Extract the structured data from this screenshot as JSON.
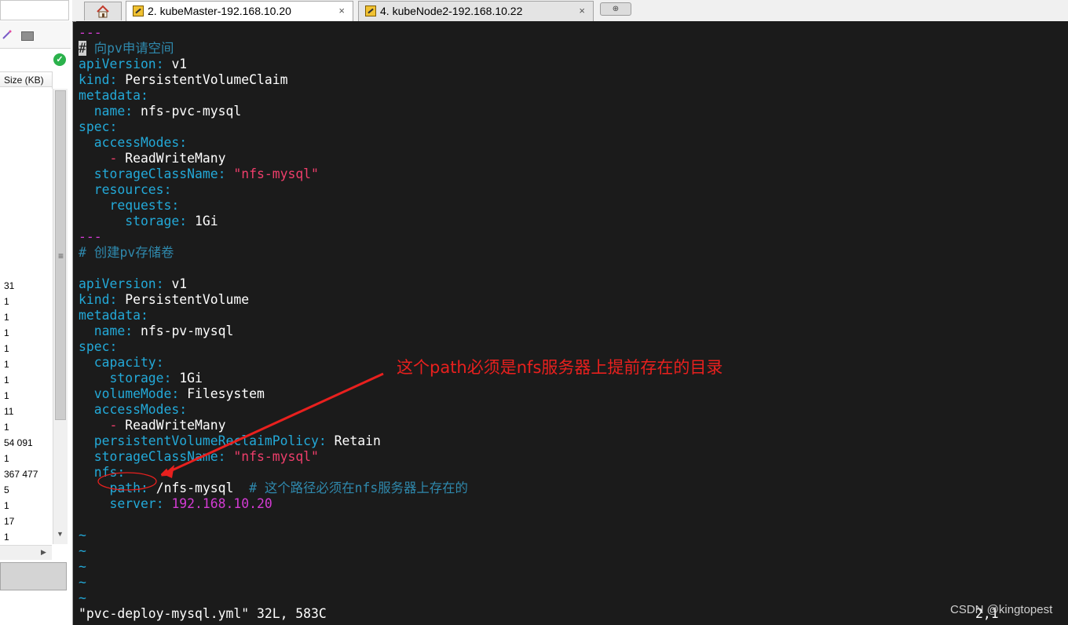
{
  "sidebar": {
    "column_header": "Size (KB)",
    "sizes": [
      "31",
      "1",
      "1",
      "1",
      "1",
      "1",
      "1",
      "1",
      "11",
      "1",
      "54 091",
      "1",
      "367 477",
      "5",
      "1",
      "17",
      "1"
    ]
  },
  "tabs": [
    {
      "label": "2. kubeMaster-192.168.10.20",
      "close": "×"
    },
    {
      "label": "4. kubeNode2-192.168.10.22",
      "close": "×"
    }
  ],
  "editor": {
    "lines": [
      [
        {
          "t": "---",
          "c": "sep"
        }
      ],
      [
        {
          "t": "#",
          "c": "cursor"
        },
        {
          "t": " 向pv申请空间",
          "c": "c"
        }
      ],
      [
        {
          "t": "apiVersion",
          "c": "k"
        },
        {
          "t": ": ",
          "c": "k"
        },
        {
          "t": "v1",
          "c": "v"
        }
      ],
      [
        {
          "t": "kind",
          "c": "k"
        },
        {
          "t": ": ",
          "c": "k"
        },
        {
          "t": "PersistentVolumeClaim",
          "c": "v"
        }
      ],
      [
        {
          "t": "metadata",
          "c": "k"
        },
        {
          "t": ":",
          "c": "k"
        }
      ],
      [
        {
          "t": "  name",
          "c": "k"
        },
        {
          "t": ": ",
          "c": "k"
        },
        {
          "t": "nfs-pvc-mysql",
          "c": "v"
        }
      ],
      [
        {
          "t": "spec",
          "c": "k"
        },
        {
          "t": ":",
          "c": "k"
        }
      ],
      [
        {
          "t": "  accessModes",
          "c": "k"
        },
        {
          "t": ":",
          "c": "k"
        }
      ],
      [
        {
          "t": "    - ",
          "c": "s"
        },
        {
          "t": "ReadWriteMany",
          "c": "v"
        }
      ],
      [
        {
          "t": "  storageClassName",
          "c": "k"
        },
        {
          "t": ": ",
          "c": "k"
        },
        {
          "t": "\"nfs-mysql\"",
          "c": "s"
        }
      ],
      [
        {
          "t": "  resources",
          "c": "k"
        },
        {
          "t": ":",
          "c": "k"
        }
      ],
      [
        {
          "t": "    requests",
          "c": "k"
        },
        {
          "t": ":",
          "c": "k"
        }
      ],
      [
        {
          "t": "      storage",
          "c": "k"
        },
        {
          "t": ": ",
          "c": "k"
        },
        {
          "t": "1Gi",
          "c": "v"
        }
      ],
      [
        {
          "t": "---",
          "c": "sep"
        }
      ],
      [
        {
          "t": "# 创建pv存储卷",
          "c": "c"
        }
      ],
      [
        {
          "t": "",
          "c": "v"
        }
      ],
      [
        {
          "t": "apiVersion",
          "c": "k"
        },
        {
          "t": ": ",
          "c": "k"
        },
        {
          "t": "v1",
          "c": "v"
        }
      ],
      [
        {
          "t": "kind",
          "c": "k"
        },
        {
          "t": ": ",
          "c": "k"
        },
        {
          "t": "PersistentVolume",
          "c": "v"
        }
      ],
      [
        {
          "t": "metadata",
          "c": "k"
        },
        {
          "t": ":",
          "c": "k"
        }
      ],
      [
        {
          "t": "  name",
          "c": "k"
        },
        {
          "t": ": ",
          "c": "k"
        },
        {
          "t": "nfs-pv-mysql",
          "c": "v"
        }
      ],
      [
        {
          "t": "spec",
          "c": "k"
        },
        {
          "t": ":",
          "c": "k"
        }
      ],
      [
        {
          "t": "  capacity",
          "c": "k"
        },
        {
          "t": ":",
          "c": "k"
        }
      ],
      [
        {
          "t": "    storage",
          "c": "k"
        },
        {
          "t": ": ",
          "c": "k"
        },
        {
          "t": "1Gi",
          "c": "v"
        }
      ],
      [
        {
          "t": "  volumeMode",
          "c": "k"
        },
        {
          "t": ": ",
          "c": "k"
        },
        {
          "t": "Filesystem",
          "c": "v"
        }
      ],
      [
        {
          "t": "  accessModes",
          "c": "k"
        },
        {
          "t": ":",
          "c": "k"
        }
      ],
      [
        {
          "t": "    - ",
          "c": "s"
        },
        {
          "t": "ReadWriteMany",
          "c": "v"
        }
      ],
      [
        {
          "t": "  persistentVolumeReclaimPolicy",
          "c": "k"
        },
        {
          "t": ": ",
          "c": "k"
        },
        {
          "t": "Retain",
          "c": "v"
        }
      ],
      [
        {
          "t": "  storageClassName",
          "c": "k"
        },
        {
          "t": ": ",
          "c": "k"
        },
        {
          "t": "\"nfs-mysql\"",
          "c": "s"
        }
      ],
      [
        {
          "t": "  nfs",
          "c": "k"
        },
        {
          "t": ":",
          "c": "k"
        }
      ],
      [
        {
          "t": "    path",
          "c": "k"
        },
        {
          "t": ": ",
          "c": "k"
        },
        {
          "t": "/nfs-mysql",
          "c": "v"
        },
        {
          "t": "  # 这个路径必须在nfs服务器上存在的",
          "c": "c"
        }
      ],
      [
        {
          "t": "    server",
          "c": "k"
        },
        {
          "t": ": ",
          "c": "k"
        },
        {
          "t": "192.168.10.20",
          "c": "ip"
        }
      ],
      [
        {
          "t": "",
          "c": "v"
        }
      ],
      [
        {
          "t": "~",
          "c": "k"
        }
      ],
      [
        {
          "t": "~",
          "c": "k"
        }
      ],
      [
        {
          "t": "~",
          "c": "k"
        }
      ],
      [
        {
          "t": "~",
          "c": "k"
        }
      ],
      [
        {
          "t": "~",
          "c": "k"
        }
      ]
    ],
    "status": "\"pvc-deploy-mysql.yml\" 32L, 583C",
    "cursor_position": "2,1"
  },
  "annotation": {
    "text": "这个path必须是nfs服务器上提前存在的目录",
    "color": "#e8201e"
  },
  "watermark": "CSDN @kingtopest",
  "colors": {
    "key": "#23a9d8",
    "string": "#ef3e6b",
    "separator": "#d33bd3",
    "comment": "#2f89ad",
    "background": "#1b1b1b"
  }
}
